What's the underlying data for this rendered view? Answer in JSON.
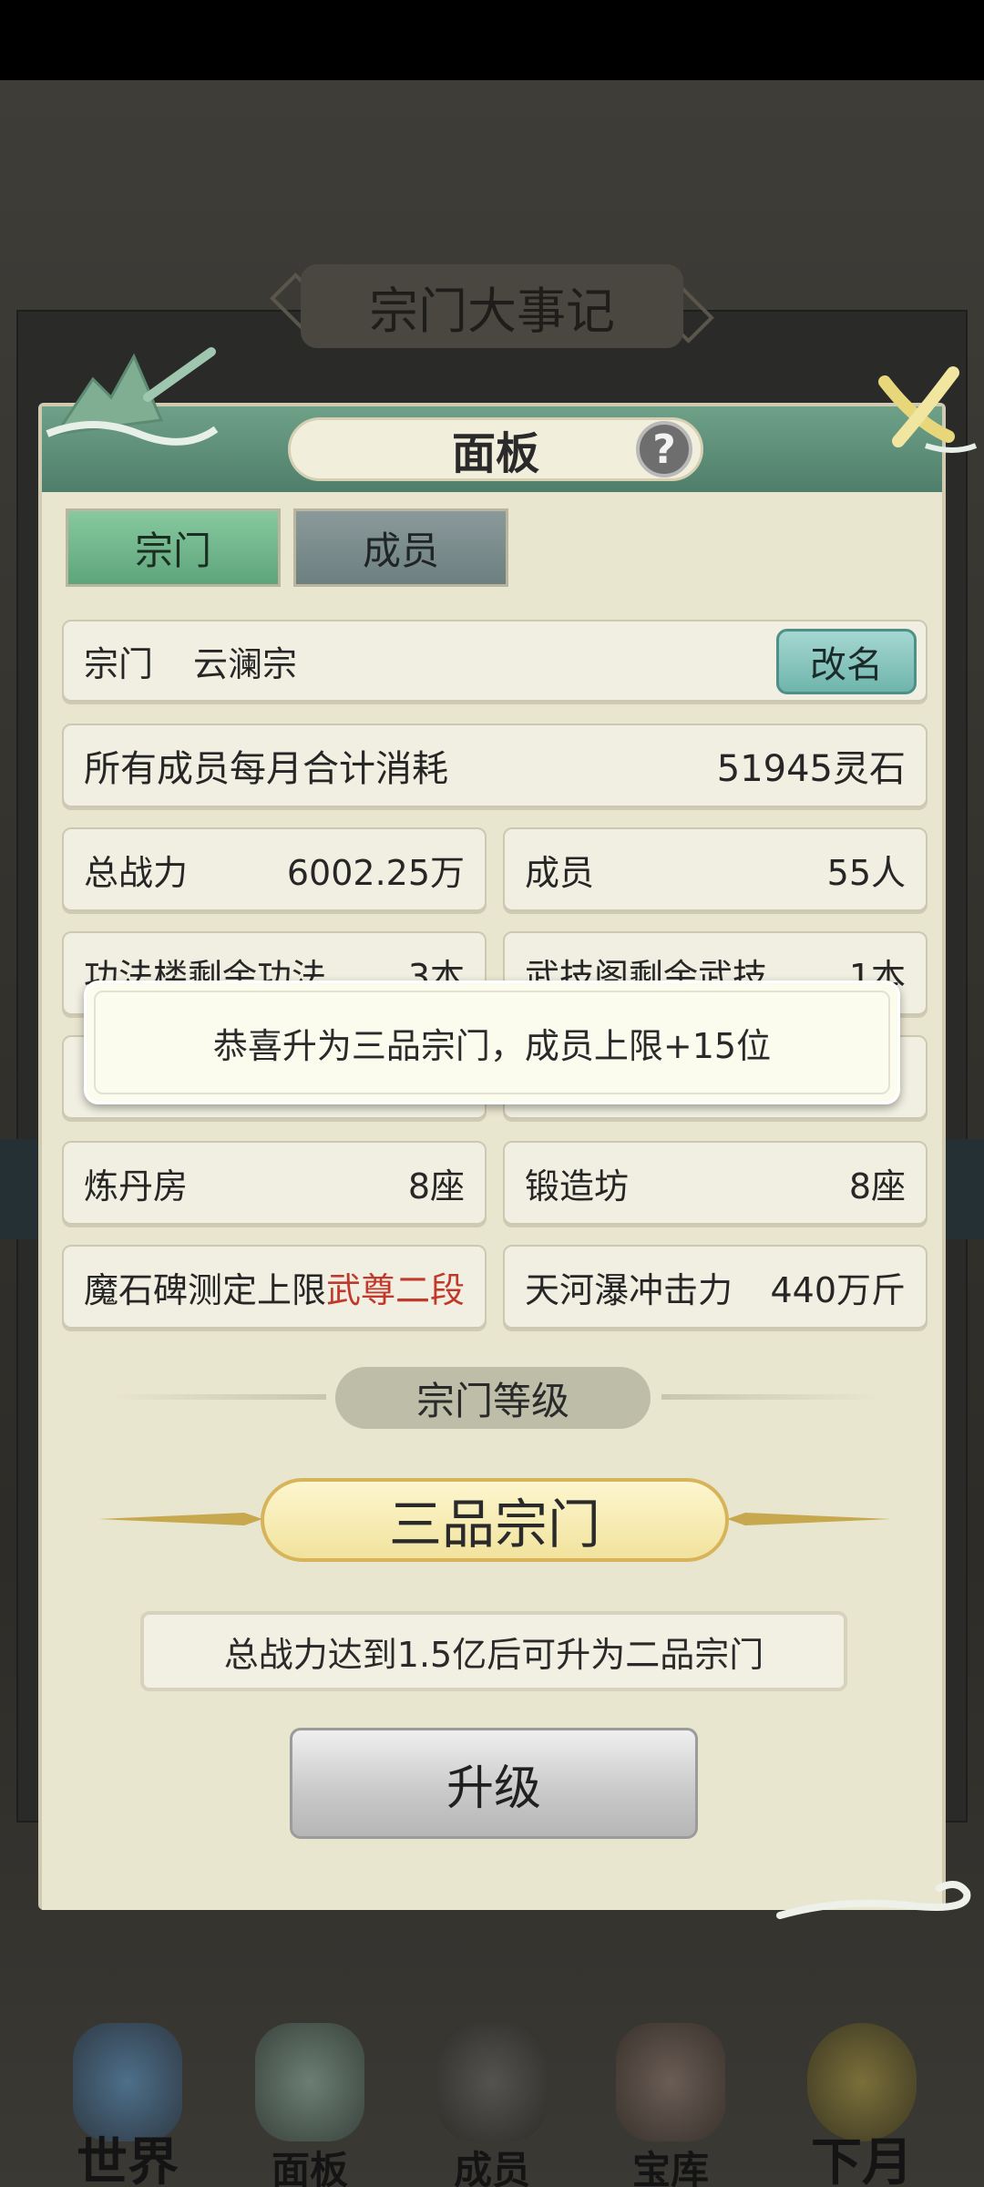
{
  "background": {
    "title": "宗门大事记"
  },
  "panel": {
    "title": "面板",
    "help_icon": "?",
    "tabs": [
      {
        "label": "宗门",
        "active": true
      },
      {
        "label": "成员",
        "active": false
      }
    ],
    "sect": {
      "label": "宗门",
      "name": "云澜宗",
      "rename_label": "改名"
    },
    "monthly_cost": {
      "label": "所有成员每月合计消耗",
      "value": "51945灵石"
    },
    "stats": [
      {
        "label": "总战力",
        "value": "6002.25万"
      },
      {
        "label": "成员",
        "value": "55人"
      },
      {
        "label": "功法楼剩余功法",
        "value": "3本"
      },
      {
        "label": "武技阁剩余武技",
        "value": "1本"
      },
      {
        "label": "炼丹房",
        "value": "8座"
      },
      {
        "label": "锻造坊",
        "value": "8座"
      },
      {
        "label": "魔石碑测定上限",
        "value": "武尊二段"
      },
      {
        "label": "天河瀑冲击力",
        "value": "440万斤"
      }
    ],
    "level_section_label": "宗门等级",
    "level": "三品宗门",
    "requirement": "总战力达到1.5亿后可升为二品宗门",
    "upgrade_label": "升级"
  },
  "toast": {
    "message": "恭喜升为三品宗门，成员上限+15位"
  },
  "nav": [
    {
      "label": "世界",
      "icon": "palace-icon"
    },
    {
      "label": "面板",
      "icon": "elder-icon"
    },
    {
      "label": "成员",
      "icon": "disciple-icon"
    },
    {
      "label": "宝库",
      "icon": "treasury-icon"
    },
    {
      "label": "下月",
      "icon": "moon-icon"
    }
  ],
  "colors": {
    "accent_green": "#5ea57b",
    "gold": "#d7b35a",
    "warning_red": "#c0392b"
  }
}
